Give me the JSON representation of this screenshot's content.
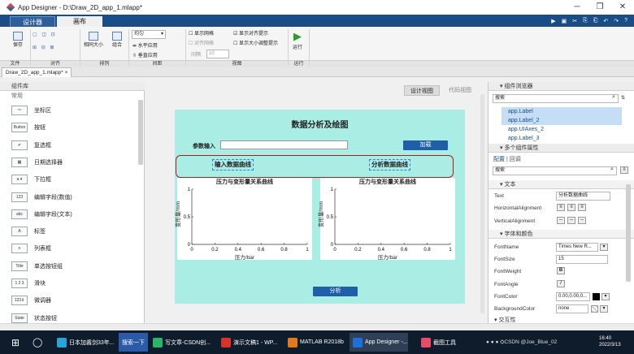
{
  "window": {
    "title": "App Designer - D:\\Draw_2D_app_1.mlapp*",
    "min": "─",
    "max": "❐",
    "close": "✕"
  },
  "tabs": {
    "designer": "设计器",
    "canvas": "画布"
  },
  "ribbon": {
    "save": "保存",
    "open_icons": "▢ ◫ ⊡",
    "align_icons": "⊞ ⊟ ⊠",
    "same_size": "相同大小",
    "group": "组合",
    "align_select": "均匀",
    "h_apply": "水平应用",
    "v_apply": "垂直应用",
    "show_grid": "显示网格",
    "snap_grid": "对齐网格",
    "interval": "间隔",
    "interval_val": "10",
    "show_align": "显示对齐提示",
    "show_resize": "显示大小调整提示",
    "run": "运行",
    "groups": [
      "文件",
      "对齐",
      "排列",
      "间距",
      "视图",
      "运行"
    ]
  },
  "file_tab": "Draw_2D_app_1.mlapp*  ×",
  "component_library": {
    "header": "组件库",
    "section": "常用",
    "items": [
      {
        "icon": "～",
        "label": "坐标区"
      },
      {
        "icon": "Button",
        "label": "按钮"
      },
      {
        "icon": "✔",
        "label": "复选框"
      },
      {
        "icon": "▦",
        "label": "日期选择器"
      },
      {
        "icon": "a ▾",
        "label": "下拉框"
      },
      {
        "icon": "123",
        "label": "编辑字段(数值)"
      },
      {
        "icon": "abc",
        "label": "编辑字段(文本)"
      },
      {
        "icon": "A",
        "label": "标签"
      },
      {
        "icon": "≡",
        "label": "列表框"
      },
      {
        "icon": "Title",
        "label": "单选按钮组"
      },
      {
        "icon": "1 2 3",
        "label": "滑块"
      },
      {
        "icon": "123⇕",
        "label": "微调器"
      },
      {
        "icon": "State",
        "label": "状态按钮"
      }
    ]
  },
  "view_toggle": {
    "design": "设计视图",
    "code": "代码视图"
  },
  "app": {
    "title": "数据分析及绘图",
    "param_label": "参数输入",
    "param_value": "",
    "load_button": "加载",
    "label_input": "输入数据曲线",
    "label_analysis": "分析数据曲线",
    "analyze_button": "分析"
  },
  "chart_data": [
    {
      "type": "line",
      "title": "压力与变形量关系曲线",
      "xlabel": "压力/bar",
      "ylabel": "变形量/mm",
      "xlim": [
        0,
        1
      ],
      "ylim": [
        0,
        1
      ],
      "xticks": [
        "0",
        "0.2",
        "0.4",
        "0.6",
        "0.8",
        "1"
      ],
      "yticks": [
        "0",
        "0.5",
        "1"
      ],
      "series": []
    },
    {
      "type": "line",
      "title": "压力与变形量关系曲线",
      "xlabel": "压力/bar",
      "ylabel": "变形量/mm",
      "xlim": [
        0,
        1
      ],
      "ylim": [
        0,
        1
      ],
      "xticks": [
        "0",
        "0.2",
        "0.4",
        "0.6",
        "0.8",
        "1"
      ],
      "yticks": [
        "0",
        "0.5",
        "1"
      ],
      "series": []
    }
  ],
  "browser": {
    "header": "组件浏览器",
    "search_placeholder": "搜索",
    "items": [
      "app.Label",
      "app.Label_2",
      "app.UIAxes_2",
      "app.Label_3"
    ]
  },
  "props": {
    "header": "多个组件属性",
    "tab_config": "配置",
    "tab_callback": "回调",
    "search_placeholder": "搜索",
    "text_section": "文本",
    "text_label": "Text",
    "text_value": "分析数据曲线",
    "halign_label": "HorizontalAlignment",
    "valign_label": "VerticalAlignment",
    "font_section": "字体和颜色",
    "fontname_label": "FontName",
    "fontname_value": "Times New R...",
    "fontsize_label": "FontSize",
    "fontsize_value": "15",
    "fontweight_label": "FontWeight",
    "fontweight_btn": "B",
    "fontangle_label": "FontAngle",
    "fontangle_btn": "I",
    "fontcolor_label": "FontColor",
    "fontcolor_value": "0.00,0.00,0...",
    "bgcolor_label": "BackgroundColor",
    "bgcolor_value": "none",
    "next_section": "交互性"
  },
  "taskbar": {
    "items": [
      "日本加酱剑33年...",
      "搜索一下",
      "写文章-CSDN创...",
      "演示文稿1 - WP...",
      "MATLAB R2018b",
      "App Designer -...",
      "截图工具"
    ],
    "time": "16:40",
    "date": "2022/3/13",
    "tray": "CSDN @Joe_Blue_02"
  },
  "colors": {
    "accent": "#1a4c86",
    "canvas": "#a9ede4",
    "button": "#1f5fa7",
    "highlight": "#b01a1a"
  }
}
